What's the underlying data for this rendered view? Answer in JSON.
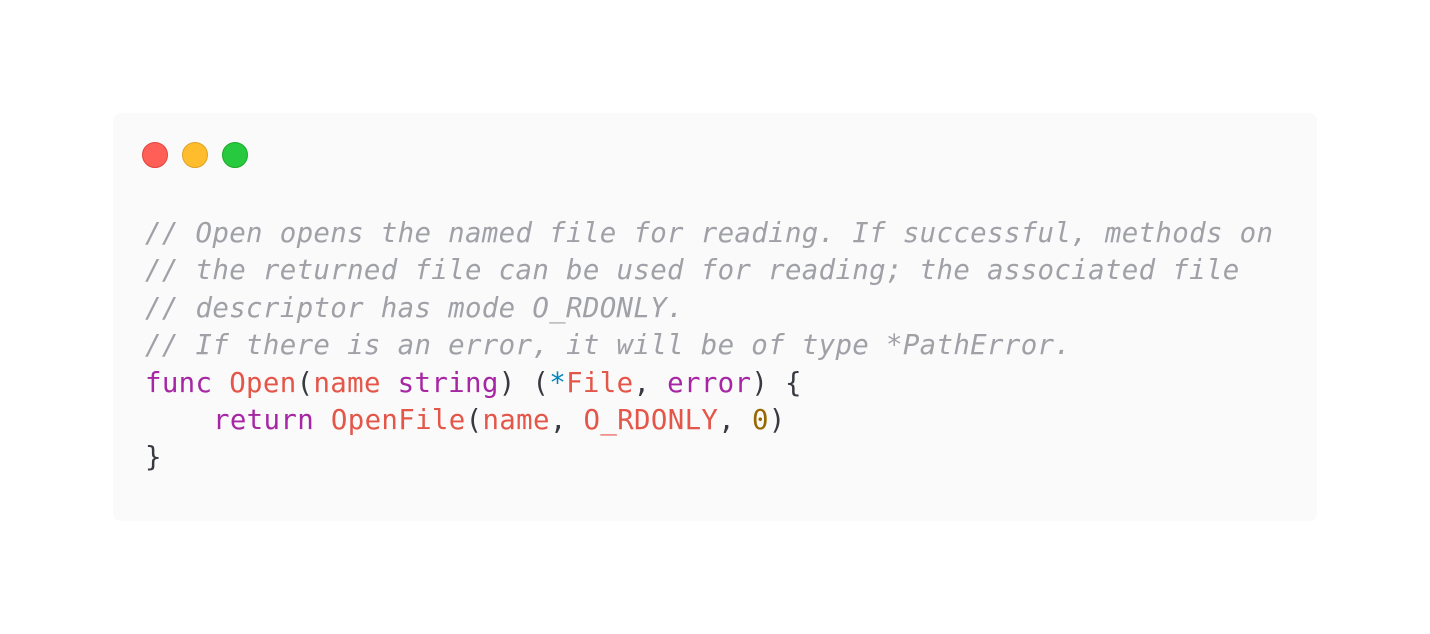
{
  "theme": {
    "background": "#ffffff",
    "window_background": "#fafafa",
    "text": "#383a42",
    "comment": "#a0a1a7",
    "keyword": "#a626a4",
    "function_name": "#e45649",
    "type": "#a626a4",
    "operator": "#0184bc",
    "number": "#986801"
  },
  "window_controls": [
    {
      "name": "close",
      "color": "#ff5f56",
      "border": "#e0443e"
    },
    {
      "name": "minimize",
      "color": "#ffbd2e",
      "border": "#dea123"
    },
    {
      "name": "zoom",
      "color": "#27c93f",
      "border": "#1aab29"
    }
  ],
  "code": {
    "language": "go",
    "comments": [
      "// Open opens the named file for reading. If successful, methods on",
      "// the returned file can be used for reading; the associated file",
      "// descriptor has mode O_RDONLY.",
      "// If there is an error, it will be of type *PathError."
    ],
    "signature": {
      "keyword": "func",
      "name": "Open",
      "open_paren": "(",
      "param_name": "name",
      "param_type": "string",
      "close_paren": ")",
      "results_open": "(",
      "pointer": "*",
      "result_type": "File",
      "comma": ",",
      "error_type": "error",
      "results_close": ")",
      "brace_open": "{"
    },
    "body": {
      "keyword": "return",
      "call_name": "OpenFile",
      "open_paren": "(",
      "arg1": "name",
      "comma1": ",",
      "arg2": "O_RDONLY",
      "comma2": ",",
      "arg3": "0",
      "close_paren": ")"
    },
    "closing_brace": "}"
  }
}
